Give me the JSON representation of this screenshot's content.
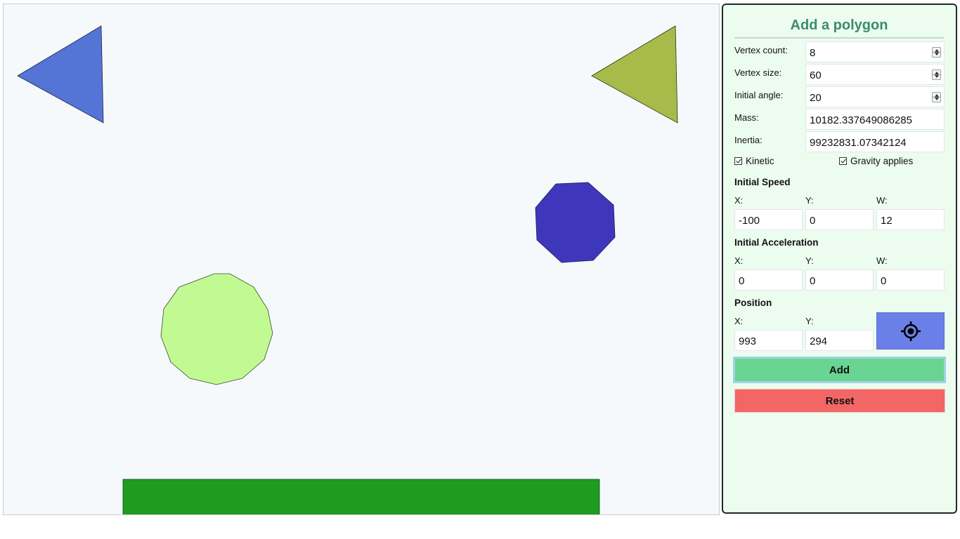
{
  "panel": {
    "title": "Add a polygon",
    "fields": {
      "vertex_count": {
        "label": "Vertex count:",
        "value": "8"
      },
      "vertex_size": {
        "label": "Vertex size:",
        "value": "60"
      },
      "initial_angle": {
        "label": "Initial angle:",
        "value": "20"
      },
      "mass": {
        "label": "Mass:",
        "value": "10182.337649086285"
      },
      "inertia": {
        "label": "Inertia:",
        "value": "99232831.07342124"
      }
    },
    "checkboxes": {
      "kinetic": {
        "label": "Kinetic",
        "checked": true
      },
      "gravity": {
        "label": "Gravity applies",
        "checked": true
      }
    },
    "initial_speed": {
      "heading": "Initial Speed",
      "x_label": "X:",
      "x": "-100",
      "y_label": "Y:",
      "y": "0",
      "w_label": "W:",
      "w": "12"
    },
    "initial_acceleration": {
      "heading": "Initial Acceleration",
      "x_label": "X:",
      "x": "0",
      "y_label": "Y:",
      "y": "0",
      "w_label": "W:",
      "w": "0"
    },
    "position": {
      "heading": "Position",
      "x_label": "X:",
      "x": "993",
      "y_label": "Y:",
      "y": "294",
      "locate_icon": "crosshair-icon"
    },
    "add_label": "Add",
    "reset_label": "Reset"
  },
  "colors": {
    "canvas_bg": "#f5f9fb",
    "panel_bg": "#ecfcef",
    "title": "#3b8b6c",
    "triangle_blue": "#5474d6",
    "triangle_olive": "#a8bb4a",
    "octagon": "#3f37bb",
    "dodecagon": "#c1fa92",
    "ground": "#209b22",
    "locate_button": "#6a7fe8",
    "add_button": "#6ad492",
    "reset_button": "#f26666"
  }
}
